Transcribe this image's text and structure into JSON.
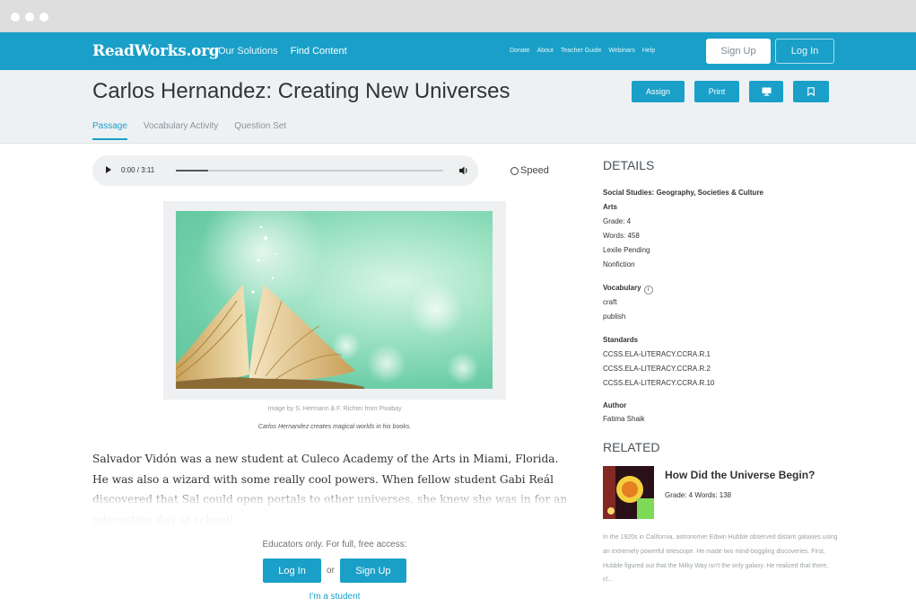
{
  "nav": {
    "logo": "ReadWorks.org",
    "main_links": [
      "Our Solutions",
      "Find Content"
    ],
    "util_links": [
      "Donate",
      "About",
      "Teacher Guide",
      "Webinars",
      "Help"
    ],
    "sign_up": "Sign Up",
    "log_in": "Log In"
  },
  "header": {
    "title": "Carlos Hernandez: Creating New Universes",
    "actions": {
      "assign": "Assign",
      "print": "Print"
    },
    "tabs": [
      "Passage",
      "Vocabulary Activity",
      "Question Set"
    ]
  },
  "audio": {
    "time": "0:00 / 3:11",
    "progress": 0.12,
    "speed": "Speed"
  },
  "figure": {
    "credit": "Image by S. Hermann & F. Richter from Pixabay",
    "caption": "Carlos Hernandez creates magical worlds in his books."
  },
  "passage": {
    "text": "Salvador Vidón was a new student at Culeco Academy of the Arts in Miami, Florida. He was also a wizard with some really cool powers. When fellow student Gabi Reál discovered that Sal could open portals to other universes, she knew she was in for an interesting day at school!"
  },
  "gate": {
    "text": "Educators only. For full, free access:",
    "log_in": "Log In",
    "or": "or",
    "sign_up": "Sign Up",
    "student": "I'm a student"
  },
  "details": {
    "heading": "DETAILS",
    "subjects": "Social Studies: Geography, Societies & Culture",
    "subject2": "Arts",
    "grade": "Grade: 4",
    "words": "Words: 458",
    "lexile": "Lexile Pending",
    "genre": "Nonfiction",
    "vocab_label": "Vocabulary",
    "vocab": [
      "craft",
      "publish"
    ],
    "standards_label": "Standards",
    "standards": [
      "CCSS.ELA-LITERACY.CCRA.R.1",
      "CCSS.ELA-LITERACY.CCRA.R.2",
      "CCSS.ELA-LITERACY.CCRA.R.10"
    ],
    "author_label": "Author",
    "author": "Fatima Shaik"
  },
  "related": {
    "heading": "RELATED",
    "title": "How Did the Universe Begin?",
    "meta": "Grade: 4  Words: 138",
    "description": "In the 1920s in California, astronomer Edwin Hubble observed distant galaxies using an extremely powerful telescope. He made two mind-boggling discoveries. First, Hubble figured out that the Milky Way isn't the only galaxy. He realized that there, cl…"
  },
  "colors": {
    "brand": "#1aa0c8"
  }
}
